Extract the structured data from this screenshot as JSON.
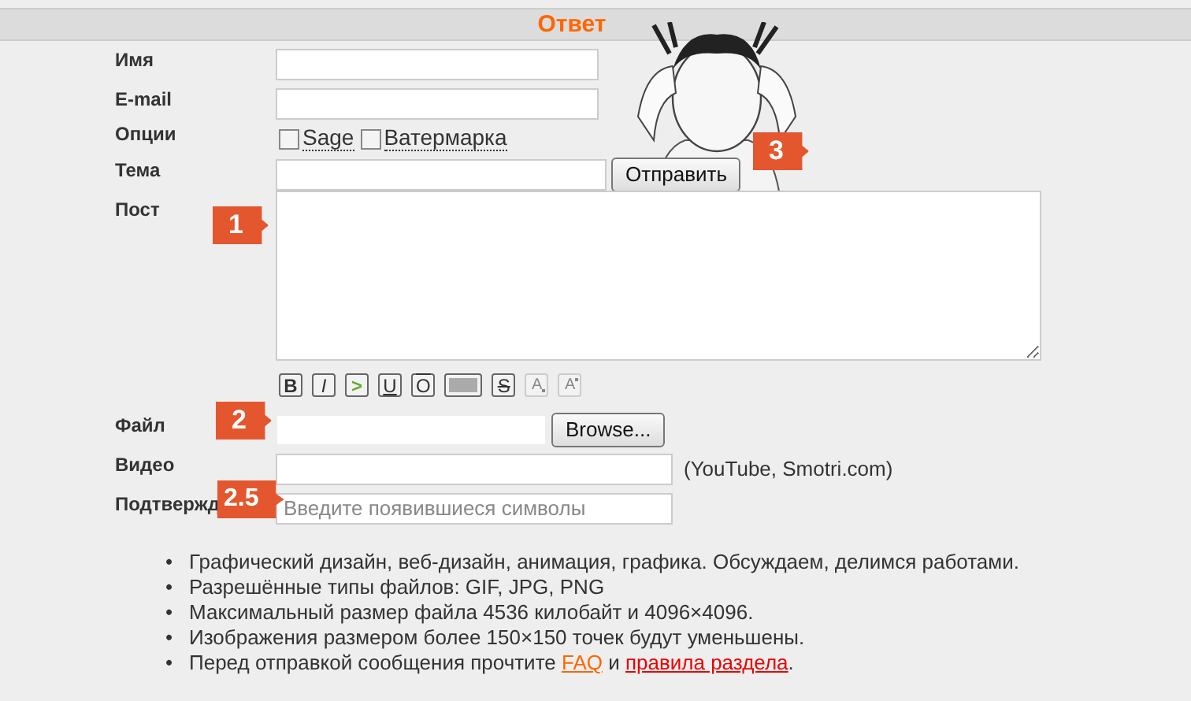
{
  "header": {
    "title": "Ответ"
  },
  "fields": [
    {
      "kind": "text",
      "label": "Имя"
    },
    {
      "kind": "text",
      "label": "E-mail"
    },
    {
      "kind": "options",
      "label": "Опции",
      "options": [
        {
          "label": "Sage",
          "checked": false
        },
        {
          "label": "Ватермарка",
          "checked": false
        }
      ]
    },
    {
      "kind": "subject",
      "label": "Тема",
      "button": "Отправить",
      "badge": "3"
    },
    {
      "kind": "post",
      "label": "Пост",
      "badge": "1",
      "toolbar": [
        {
          "kind": "bold",
          "label": "B"
        },
        {
          "kind": "italic",
          "label": "I"
        },
        {
          "kind": "quote",
          "label": ">"
        },
        {
          "kind": "underline",
          "label": "U"
        },
        {
          "kind": "overline",
          "label": "O"
        },
        {
          "kind": "spoiler"
        },
        {
          "kind": "strike",
          "label": "S"
        },
        {
          "kind": "sub",
          "label": "A"
        },
        {
          "kind": "sup",
          "label": "A"
        }
      ]
    },
    {
      "kind": "file",
      "label": "Файл",
      "button": "Browse...",
      "badge": "2"
    },
    {
      "kind": "video",
      "label": "Видео",
      "note": "(YouTube, Smotri.com)"
    },
    {
      "kind": "captcha",
      "label": "Подтвержд",
      "placeholder": "Введите появившиеся символы",
      "badge": "2.5"
    }
  ],
  "rules": [
    {
      "marker": "•",
      "text": "Графический дизайн, веб-дизайн, анимация, графика. Обсуждаем, делимся работами."
    },
    {
      "marker": "•",
      "text": "Разрешённые типы файлов: GIF, JPG, PNG"
    },
    {
      "marker": "•",
      "text": "Максимальный размер файла 4536 килобайт и 4096×4096."
    },
    {
      "marker": "•",
      "text": "Изображения размером более 150×150 точек будут уменьшены."
    },
    {
      "marker": "•",
      "text": "Перед отправкой сообщения прочтите ",
      "links": [
        {
          "text": "FAQ",
          "kind": "faq"
        },
        {
          "text": " и ",
          "kind": "plain"
        },
        {
          "text": "правила раздела",
          "kind": "rules"
        },
        {
          "text": ".",
          "kind": "plain"
        }
      ]
    }
  ]
}
